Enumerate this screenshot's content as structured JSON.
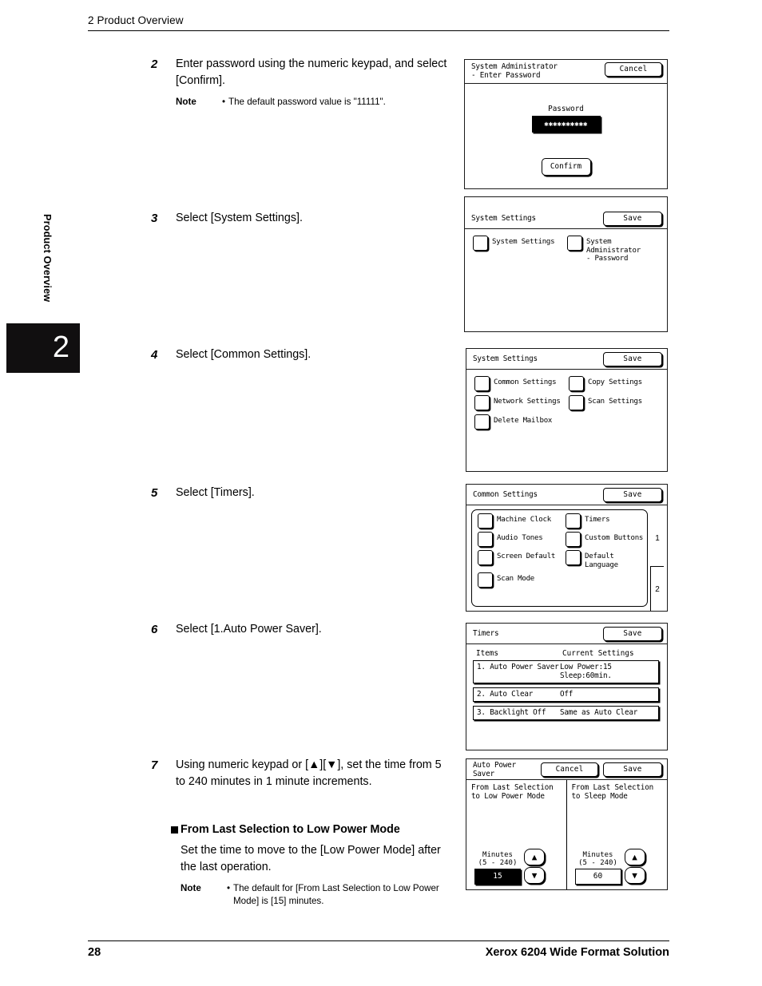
{
  "header": {
    "chapter_title": "2 Product Overview"
  },
  "side_tab": {
    "label": "Product Overview",
    "number": "2"
  },
  "footer": {
    "page_number": "28",
    "book_title": "Xerox 6204 Wide Format Solution"
  },
  "steps": [
    {
      "number": "2",
      "text": "Enter password using the numeric keypad, and select [Confirm].",
      "note_label": "Note",
      "note_bullet": "•",
      "note_text": "The default password value is \"11111\"."
    },
    {
      "number": "3",
      "text": "Select [System Settings]."
    },
    {
      "number": "4",
      "text": "Select [Common Settings]."
    },
    {
      "number": "5",
      "text": "Select [Timers]."
    },
    {
      "number": "6",
      "text": "Select [1.Auto Power Saver]."
    },
    {
      "number": "7",
      "text": "Using numeric keypad or [▲][▼], set the time from 5 to 240 minutes in 1 minute increments."
    }
  ],
  "subsection": {
    "heading": "From Last Selection to Low Power Mode",
    "paragraph": "Set the time to move to the [Low Power Mode] after the last operation.",
    "note_label": "Note",
    "note_bullet": "•",
    "note_text": "The default for [From Last Selection to Low Power Mode] is [15] minutes."
  },
  "panels": {
    "enter_password": {
      "title": "System Administrator\n- Enter Password",
      "cancel_label": "Cancel",
      "password_label": "Password",
      "password_value": "✱✱✱✱✱✱✱✱✱✱",
      "confirm_label": "Confirm"
    },
    "system_settings_1": {
      "title": "System Settings",
      "save_label": "Save",
      "items": [
        {
          "label": "System Settings"
        },
        {
          "label": "System\nAdministrator\n- Password"
        }
      ]
    },
    "system_settings_2": {
      "title": "System Settings",
      "save_label": "Save",
      "items": [
        {
          "label": "Common Settings"
        },
        {
          "label": "Copy Settings"
        },
        {
          "label": "Network Settings"
        },
        {
          "label": "Scan Settings"
        },
        {
          "label": "Delete Mailbox"
        }
      ]
    },
    "common_settings": {
      "title": "Common Settings",
      "save_label": "Save",
      "items": [
        {
          "label": "Machine Clock"
        },
        {
          "label": "Timers"
        },
        {
          "label": "Audio Tones"
        },
        {
          "label": "Custom Buttons"
        },
        {
          "label": "Screen Default"
        },
        {
          "label": "Default Language"
        },
        {
          "label": "Scan Mode"
        }
      ],
      "page_markers": [
        "1",
        "2"
      ]
    },
    "timers": {
      "title": "Timers",
      "save_label": "Save",
      "columns": [
        "Items",
        "Current Settings"
      ],
      "rows": [
        {
          "item": "1. Auto Power Saver",
          "setting": "Low Power:15  Sleep:60min."
        },
        {
          "item": "2. Auto Clear",
          "setting": "Off"
        },
        {
          "item": "3. Backlight Off",
          "setting": "Same as Auto Clear"
        }
      ]
    },
    "auto_power_saver": {
      "title": "Auto Power Saver",
      "cancel_label": "Cancel",
      "save_label": "Save",
      "left": {
        "caption": "From Last Selection\nto Low Power Mode",
        "minutes_label": "Minutes\n(5 - 240)",
        "value": "15",
        "up_glyph": "▲",
        "down_glyph": "▼"
      },
      "right": {
        "caption": "From Last Selection\nto Sleep Mode",
        "minutes_label": "Minutes\n(5 - 240)",
        "value": "60",
        "up_glyph": "▲",
        "down_glyph": "▼"
      }
    }
  }
}
